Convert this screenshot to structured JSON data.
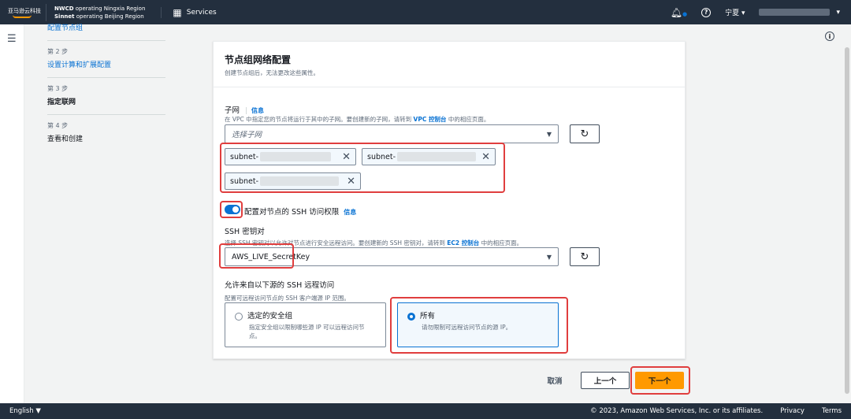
{
  "nav": {
    "logo": "亚马逊云科技",
    "region_line1_bold": "NWCD",
    "region_line1": " operating Ningxia Region",
    "region_line2_bold": "Sinnet",
    "region_line2": " operating Beijing Region",
    "services": "Services",
    "region_select": "宁夏 ▾"
  },
  "steps": [
    {
      "label": "配置节点组"
    },
    {
      "num": "第 2 步",
      "label": "设置计算和扩展配置"
    },
    {
      "num": "第 3 步",
      "label": "指定联网"
    },
    {
      "num": "第 4 步",
      "label": "查看和创建"
    }
  ],
  "panel": {
    "title": "节点组网络配置",
    "desc": "创建节点组后，无法更改这些属性。",
    "subnet": {
      "label": "子网",
      "info": "信息",
      "desc_a": "在 VPC 中指定您的节点将运行于其中的子网。要创建新的子网，请转到 ",
      "desc_link": "VPC 控制台",
      "desc_b": " 中的相应页面。",
      "placeholder": "选择子网",
      "tokens": [
        "subnet-",
        "subnet-",
        "subnet-"
      ]
    },
    "ssh_toggle": {
      "label": "配置对节点的 SSH 访问权限",
      "info": "信息",
      "on": true
    },
    "keypair": {
      "label": "SSH 密钥对",
      "desc_a": "选择 SSH 密钥对以允许对节点进行安全远程访问。要创建新的 SSH 密钥对，请转到 ",
      "desc_link": "EC2 控制台",
      "desc_b": " 中的相应页面。",
      "value": "AWS_LIVE_SecretKey"
    },
    "source": {
      "label": "允许来自以下源的 SSH 远程访问",
      "desc": "配置可远程访问节点的 SSH 客户端源 IP 范围。",
      "options": [
        {
          "title": "选定的安全组",
          "desc": "指定安全组以限制哪些源 IP 可以远程访问节点。",
          "selected": false
        },
        {
          "title": "所有",
          "desc": "请勿限制可远程访问节点的源 IP。",
          "selected": true
        }
      ]
    }
  },
  "actions": {
    "cancel": "取消",
    "prev": "上一个",
    "next": "下一个"
  },
  "footer": {
    "lang": "English ▼",
    "copyright": "© 2023, Amazon Web Services, Inc. or its affiliates.",
    "privacy": "Privacy",
    "terms": "Terms"
  }
}
